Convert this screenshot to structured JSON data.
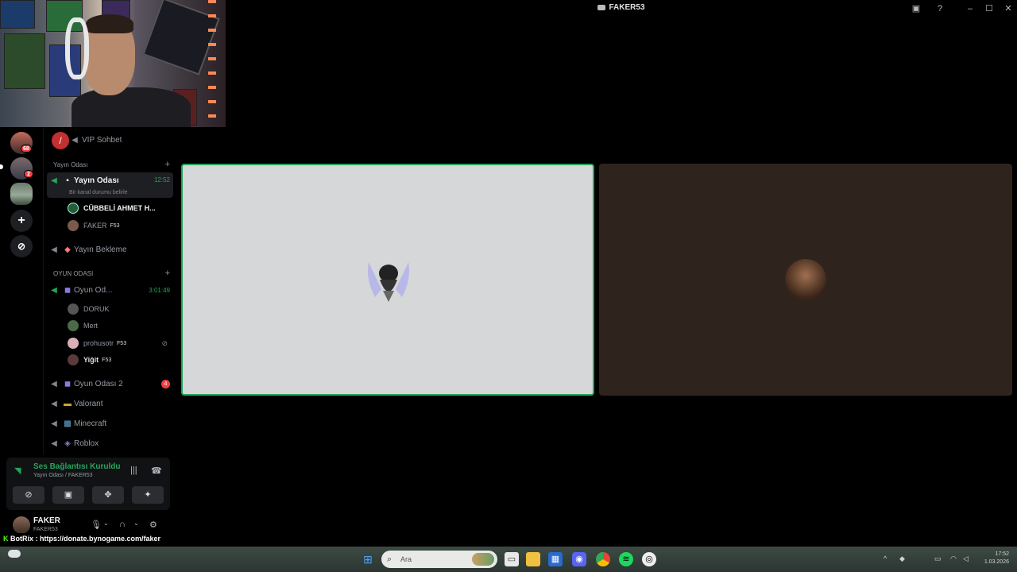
{
  "window": {
    "title": "FAKER53"
  },
  "servers": {
    "badge1": "68",
    "badge2": "2"
  },
  "channels": {
    "vip": {
      "label": "VIP Sohbet"
    },
    "category1": {
      "label": "Yayın Odası"
    },
    "yayin_odasi": {
      "label": "Yayın Odası",
      "time": "12:52",
      "status": "Bir kanal durumu belirle"
    },
    "yayin_users": [
      {
        "name": "CÜBBELİ AHMET H...",
        "tag": ""
      },
      {
        "name": "FAKER",
        "tag": "F53"
      }
    ],
    "yayin_bekleme": {
      "label": "Yayın Bekleme"
    },
    "category2": {
      "label": "OYUN ODASI"
    },
    "oyun_odasi": {
      "label": "Oyun Od...",
      "time": "3:01:49"
    },
    "oyun_users": [
      {
        "name": "DORUK",
        "tag": ""
      },
      {
        "name": "Mert",
        "tag": ""
      },
      {
        "name": "prohusotr",
        "tag": "F53"
      },
      {
        "name": "Yiğit",
        "tag": "F53"
      }
    ],
    "oyun_odasi_2": {
      "label": "Oyun Odası 2",
      "badge": "4"
    },
    "valorant": {
      "label": "Valorant"
    },
    "minecraft": {
      "label": "Minecraft"
    },
    "roblox": {
      "label": "Roblox"
    }
  },
  "voice": {
    "status": "Ses Bağlantısı Kuruldu",
    "location": "Yayın Odası / FAKER53"
  },
  "user_panel": {
    "name": "FAKER",
    "subtitle": "FAKER53"
  },
  "botrix": {
    "brand": "BotRix",
    "text": ": https://donate.bynogame.com/faker"
  },
  "taskbar": {
    "search_placeholder": "Ara",
    "clock_time": "17:52",
    "clock_date": "1.03.2026"
  },
  "icons": {
    "speaker": "speaker-icon",
    "camera": "camera-icon",
    "settings": "gear-icon",
    "headphones": "headphones-icon",
    "microphone": "microphone-icon"
  },
  "colors": {
    "connected_green": "#23a55a",
    "badge_red": "#f23f43",
    "active_tile_border": "#23a55a"
  }
}
